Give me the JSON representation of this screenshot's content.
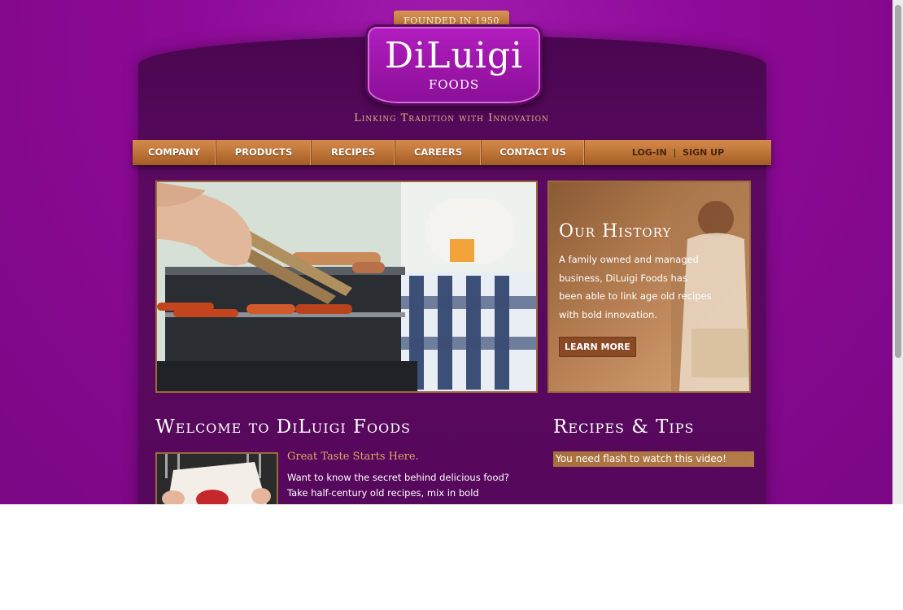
{
  "brand": {
    "ribbon": "FOUNDED IN 1950",
    "name": "DiLuigi",
    "sub": "FOODS",
    "tagline": "Linking Tradition with Innovation"
  },
  "nav": {
    "items": [
      {
        "label": "COMPANY"
      },
      {
        "label": "PRODUCTS"
      },
      {
        "label": "RECIPES"
      },
      {
        "label": "CAREERS"
      },
      {
        "label": "CONTACT US"
      }
    ],
    "login": "LOG-IN",
    "separator": "|",
    "signup": "SIGN UP"
  },
  "history": {
    "title": "Our History",
    "text": "A family owned and managed business, DiLuigi Foods has been able to link age old recipes with bold innovation.",
    "button": "LEARN MORE"
  },
  "welcome": {
    "heading": "Welcome to DiLuigi Foods",
    "subheading": "Great Taste Starts Here.",
    "body": "Want to know the secret behind delicious food? Take half-century old recipes, mix in bold innovation, and top with a state-of-the-art facility that brings the"
  },
  "recipes": {
    "heading": "Recipes & Tips",
    "flash_notice": "You need flash to watch this video!"
  },
  "colors": {
    "background": "#8e0a98",
    "panel": "#54085a",
    "accent_copper": "#c0773a",
    "tagline_gold": "#d8b47f"
  }
}
